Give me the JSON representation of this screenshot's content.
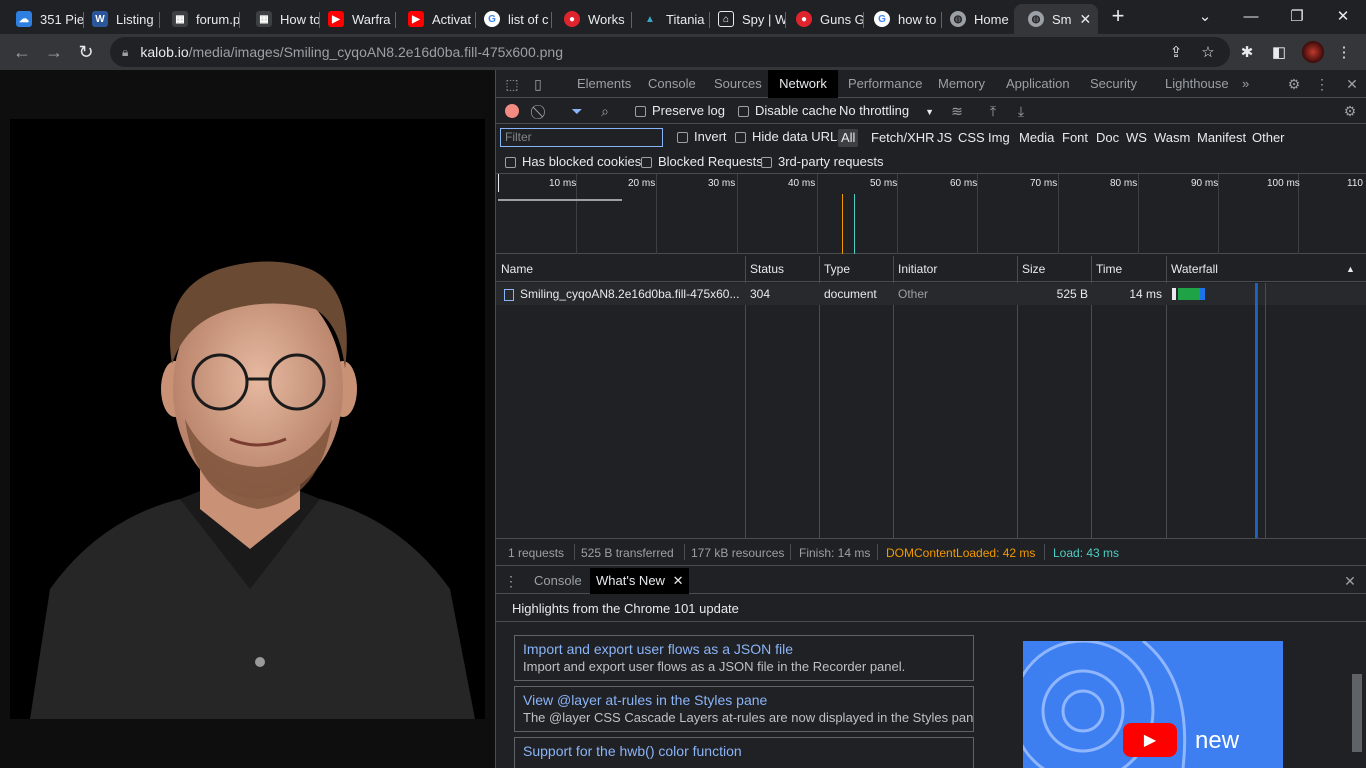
{
  "tabs": [
    {
      "title": "351 Pie",
      "icon": "cloud-icon",
      "color": "#2f7fe0"
    },
    {
      "title": "Listing",
      "icon": "word-icon",
      "color": "#2b579a"
    },
    {
      "title": "forum.p",
      "icon": "pixel-icon",
      "color": "#5f6368"
    },
    {
      "title": "How to",
      "icon": "pixel-icon",
      "color": "#5f6368"
    },
    {
      "title": "Warfra",
      "icon": "youtube-icon",
      "color": "#ff0000"
    },
    {
      "title": "Activat",
      "icon": "youtube-icon",
      "color": "#ff0000"
    },
    {
      "title": "list of c",
      "icon": "google-icon",
      "color": "#ffffff"
    },
    {
      "title": "Works",
      "icon": "red-circle-icon",
      "color": "#e0242d"
    },
    {
      "title": "Titania",
      "icon": "titania-icon",
      "color": "#3aa7c9"
    },
    {
      "title": "Spy | W",
      "icon": "house-icon",
      "color": "#ffffff"
    },
    {
      "title": "Guns G",
      "icon": "red-circle-icon",
      "color": "#e0242d"
    },
    {
      "title": "how to",
      "icon": "google-icon",
      "color": "#ffffff"
    },
    {
      "title": "Home",
      "icon": "globe-icon",
      "color": "#9aa0a6"
    },
    {
      "title": "Sm",
      "icon": "globe-icon",
      "color": "#9aa0a6",
      "active": true
    }
  ],
  "address": {
    "host": "kalob.io",
    "path": "/media/images/Smiling_cyqoAN8.2e16d0ba.fill-475x600.png"
  },
  "devtools": {
    "panels": [
      "Elements",
      "Console",
      "Sources",
      "Network",
      "Performance",
      "Memory",
      "Application",
      "Security",
      "Lighthouse"
    ],
    "active_panel": "Network",
    "more_label": "»",
    "toolbar": {
      "preserve_log": "Preserve log",
      "disable_cache": "Disable cache",
      "throttling": "No throttling"
    },
    "filter": {
      "placeholder": "Filter",
      "invert": "Invert",
      "hide_data_urls": "Hide data URLs",
      "types": [
        "All",
        "Fetch/XHR",
        "JS",
        "CSS",
        "Img",
        "Media",
        "Font",
        "Doc",
        "WS",
        "Wasm",
        "Manifest",
        "Other"
      ],
      "active_type": "All",
      "has_blocked_cookies": "Has blocked cookies",
      "blocked_requests": "Blocked Requests",
      "third_party": "3rd-party requests"
    },
    "overview_ticks": [
      "10 ms",
      "20 ms",
      "30 ms",
      "40 ms",
      "50 ms",
      "60 ms",
      "70 ms",
      "80 ms",
      "90 ms",
      "100 ms",
      "110"
    ],
    "table": {
      "columns": [
        "Name",
        "Status",
        "Type",
        "Initiator",
        "Size",
        "Time",
        "Waterfall"
      ],
      "rows": [
        {
          "name": "Smiling_cyqoAN8.2e16d0ba.fill-475x60...",
          "status": "304",
          "type": "document",
          "initiator": "Other",
          "size": "525 B",
          "time": "14 ms"
        }
      ]
    },
    "summary": {
      "requests": "1 requests",
      "transferred": "525 B transferred",
      "resources": "177 kB resources",
      "finish": "Finish: 14 ms",
      "dom_content_loaded": "DOMContentLoaded: 42 ms",
      "load": "Load: 43 ms"
    },
    "drawer": {
      "tabs": [
        "Console",
        "What's New"
      ],
      "active_tab": "What's New",
      "heading": "Highlights from the Chrome 101 update",
      "items": [
        {
          "title": "Import and export user flows as a JSON file",
          "desc": "Import and export user flows as a JSON file in the Recorder panel."
        },
        {
          "title": "View @layer at-rules in the Styles pane",
          "desc": "The @layer CSS Cascade Layers at-rules are now displayed in the Styles pane."
        },
        {
          "title": "Support for the hwb() color function",
          "desc": ""
        }
      ],
      "video_caption": "new"
    },
    "colors": {
      "dcl": "#f29900",
      "load": "#4ecdc4",
      "accent": "#8ab4f8"
    }
  }
}
